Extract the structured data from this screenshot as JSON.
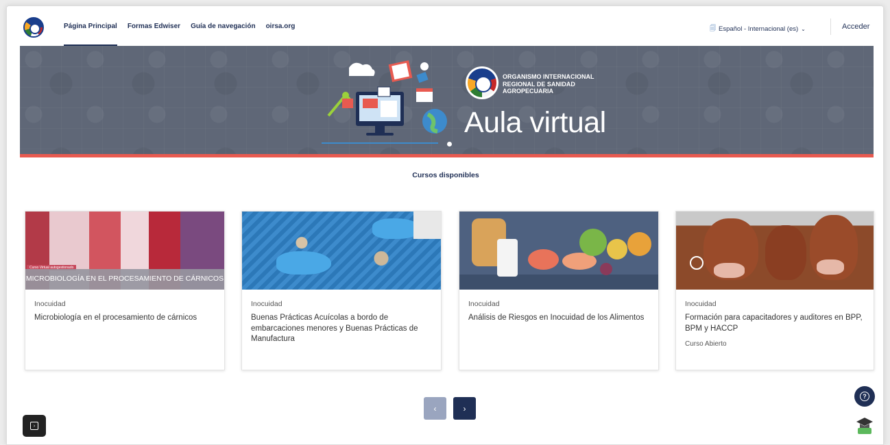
{
  "nav": {
    "links": [
      "Página Principal",
      "Formas Edwiser",
      "Guía de navegación",
      "oirsa.org"
    ],
    "language": "Español - Internacional (es)",
    "login": "Acceder"
  },
  "hero": {
    "org_name": "ORGANISMO INTERNACIONAL REGIONAL DE SANIDAD AGROPECUARIA",
    "title": "Aula virtual"
  },
  "section_title": "Cursos disponibles",
  "courses": [
    {
      "category": "Inocuidad",
      "title": "Microbiología en el procesamiento de cárnicos",
      "extra": "",
      "image_text": "MICROBIOLOGÍA EN EL PROCESAMIENTO DE CÁRNICOS",
      "image_tag": "Curso Virtual autogestionado"
    },
    {
      "category": "Inocuidad",
      "title": "Buenas Prácticas Acuícolas a bordo de embarcaciones menores y Buenas Prácticas de Manufactura",
      "extra": ""
    },
    {
      "category": "Inocuidad",
      "title": "Análisis de Riesgos en Inocuidad de los Alimentos",
      "extra": ""
    },
    {
      "category": "Inocuidad",
      "title": "Formación para capacitadores y auditores en BPP, BPM y HACCP",
      "extra": "Curso Abierto"
    }
  ],
  "pagination": {
    "prev": "‹",
    "next": "›"
  },
  "icons": {
    "drawer": "drawer-toggle-icon",
    "help": "help-icon",
    "graduation": "graduation-cap-icon",
    "language": "language-icon"
  },
  "colors": {
    "primary": "#1f2f55",
    "accent_bar": "#e85a50",
    "hero_bg": "#5f6777"
  }
}
